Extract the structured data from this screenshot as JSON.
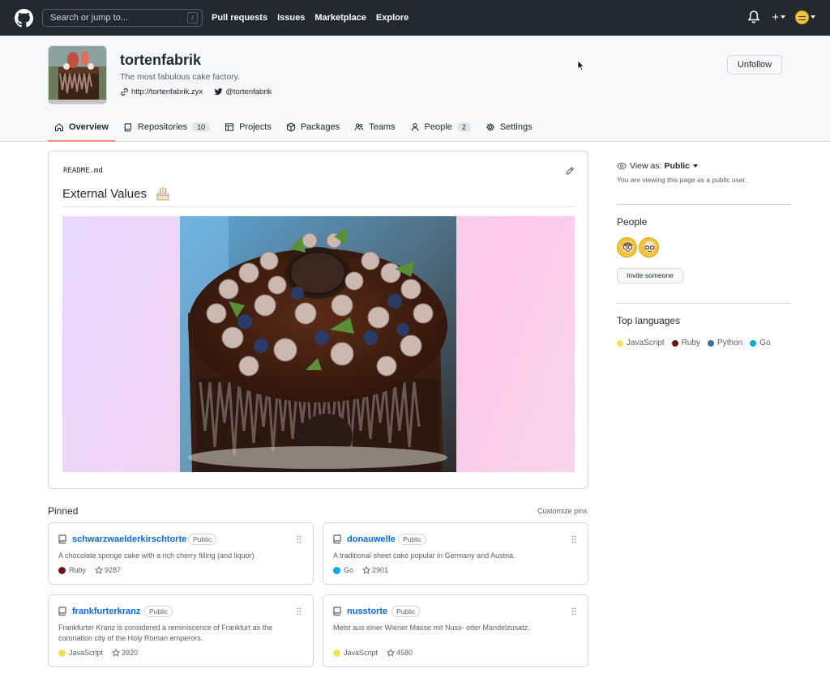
{
  "nav": {
    "search_placeholder": "Search or jump to...",
    "search_shortcut": "/",
    "links": [
      "Pull requests",
      "Issues",
      "Marketplace",
      "Explore"
    ],
    "plus": "+"
  },
  "org": {
    "name": "tortenfabrik",
    "description": "The most fabulous cake factory.",
    "website": "http://tortenfabrik.zyx",
    "twitter": "@tortenfabrik",
    "unfollow_label": "Unfollow"
  },
  "tabs": [
    {
      "label": "Overview",
      "icon": "home-icon",
      "active": true
    },
    {
      "label": "Repositories",
      "icon": "repo-icon",
      "count": "10"
    },
    {
      "label": "Projects",
      "icon": "table-icon"
    },
    {
      "label": "Packages",
      "icon": "package-icon"
    },
    {
      "label": "Teams",
      "icon": "people-icon"
    },
    {
      "label": "People",
      "icon": "person-icon",
      "count": "2"
    },
    {
      "label": "Settings",
      "icon": "gear-icon"
    }
  ],
  "readme": {
    "filename": "README.md",
    "title": "External Values"
  },
  "pinned": {
    "title": "Pinned",
    "customize_label": "Customize pins",
    "repos": [
      {
        "name": "schwarzwaelderkirschtorte",
        "visibility": "Public",
        "description": "A chocolate sponge cake with a rich cherry filling (and liquor)",
        "language": "Ruby",
        "language_color": "#701516",
        "stars": "9287"
      },
      {
        "name": "donauwelle",
        "visibility": "Public",
        "description": "A traditional sheet cake popular in Germany and Austria.",
        "language": "Go",
        "language_color": "#00ADD8",
        "stars": "2901"
      },
      {
        "name": "frankfurterkranz",
        "visibility": "Public",
        "description": "Frankfurter Kranz is considered a reminiscence of Frankfurt as the coronation city of the Holy Roman emperors.",
        "language": "JavaScript",
        "language_color": "#f1e05a",
        "stars": "3920"
      },
      {
        "name": "nusstorte",
        "visibility": "Public",
        "description": "Meist aus einer Wiener Masse mit Nuss- oder Mandelzusatz.",
        "language": "JavaScript",
        "language_color": "#f1e05a",
        "stars": "4580"
      }
    ]
  },
  "sidebar": {
    "view_as_label": "View as:",
    "view_as_value": "Public",
    "viewing_note": "You are viewing this page as a public user.",
    "people_title": "People",
    "invite_label": "Invite someone",
    "languages_title": "Top languages",
    "languages": [
      {
        "name": "JavaScript",
        "color": "#f1e05a"
      },
      {
        "name": "Ruby",
        "color": "#701516"
      },
      {
        "name": "Python",
        "color": "#3572A5"
      },
      {
        "name": "Go",
        "color": "#00ADD8"
      }
    ]
  },
  "colors": {
    "nav_bg": "#24292f",
    "link_blue": "#0969da",
    "tab_underline": "#fd8c73"
  }
}
